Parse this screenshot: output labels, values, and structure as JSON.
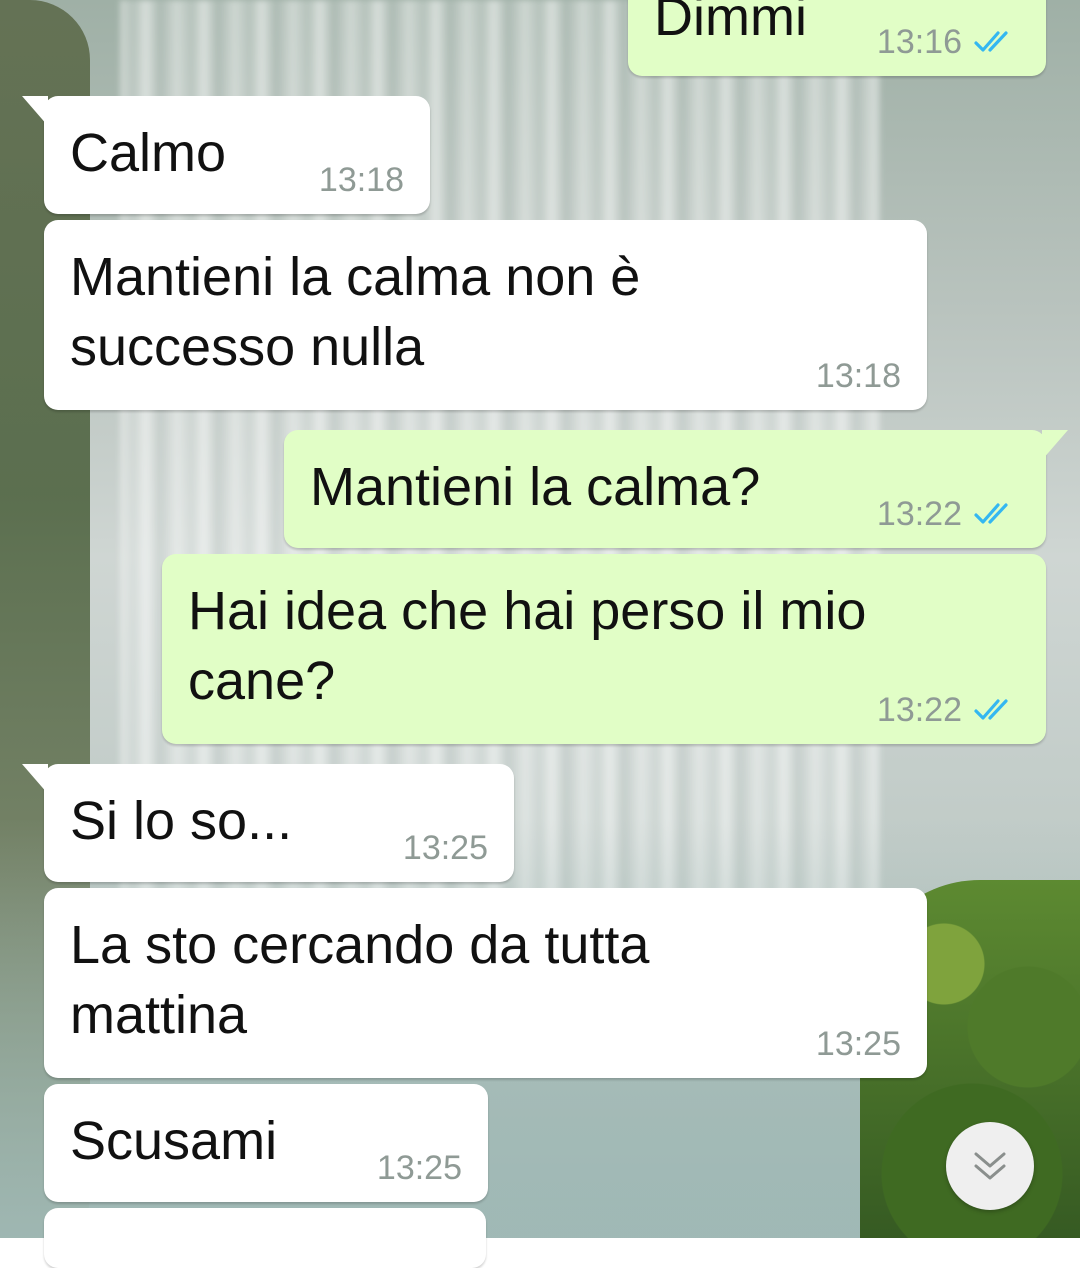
{
  "messages": [
    {
      "id": "m1",
      "direction": "out",
      "text": "Dimmi",
      "time": "13:16",
      "status": "read"
    },
    {
      "id": "m2",
      "direction": "in",
      "text": "Calmo",
      "time": "13:18"
    },
    {
      "id": "m3",
      "direction": "in",
      "text": "Mantieni la calma non è\nsuccesso nulla",
      "time": "13:18"
    },
    {
      "id": "m4",
      "direction": "out",
      "text": "Mantieni la calma?",
      "time": "13:22",
      "status": "read"
    },
    {
      "id": "m5",
      "direction": "out",
      "text": "Hai idea che hai perso il mio\ncane?",
      "time": "13:22",
      "status": "read"
    },
    {
      "id": "m6",
      "direction": "in",
      "text": "Si lo so...",
      "time": "13:25"
    },
    {
      "id": "m7",
      "direction": "in",
      "text": "La sto cercando da tutta\nmattina",
      "time": "13:25"
    },
    {
      "id": "m8",
      "direction": "in",
      "text": "Scusami",
      "time": "13:25"
    }
  ],
  "colors": {
    "incoming_bubble": "#ffffff",
    "outgoing_bubble": "#e1fec6",
    "read_ticks": "#34b7f1",
    "timestamp": "#8f9a95"
  },
  "scroll_button": {
    "icon": "double-chevron-down-icon"
  }
}
